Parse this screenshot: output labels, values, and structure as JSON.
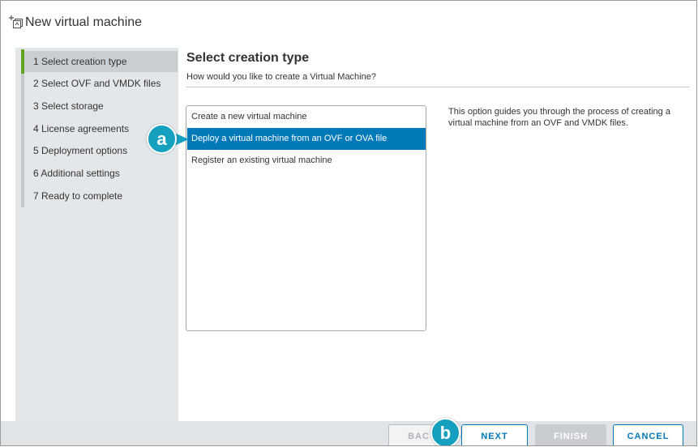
{
  "window": {
    "title": "New virtual machine",
    "title_icon": "new-vm-icon"
  },
  "sidebar": {
    "steps": [
      {
        "label": "1  Select creation type",
        "active": true
      },
      {
        "label": "2  Select OVF and VMDK files",
        "active": false
      },
      {
        "label": "3  Select storage",
        "active": false
      },
      {
        "label": "4  License agreements",
        "active": false
      },
      {
        "label": "5  Deployment options",
        "active": false
      },
      {
        "label": "6  Additional settings",
        "active": false
      },
      {
        "label": "7  Ready to complete",
        "active": false
      }
    ]
  },
  "main": {
    "title": "Select creation type",
    "subtitle": "How would you like to create a Virtual Machine?",
    "options": [
      {
        "label": "Create a new virtual machine",
        "selected": false
      },
      {
        "label": "Deploy a virtual machine from an OVF or OVA file",
        "selected": true
      },
      {
        "label": "Register an existing virtual machine",
        "selected": false
      }
    ],
    "description": "This option guides you through the process of creating a virtual machine from an OVF and VMDK files."
  },
  "footer": {
    "back_label": "BAC",
    "next_label": "NEXT",
    "finish_label": "FINISH",
    "cancel_label": "CANCEL"
  },
  "callouts": {
    "a": "a",
    "b": "b"
  },
  "colors": {
    "accent": "#0079b8",
    "active_step": "#62a420",
    "callout": "#16a0c0"
  }
}
